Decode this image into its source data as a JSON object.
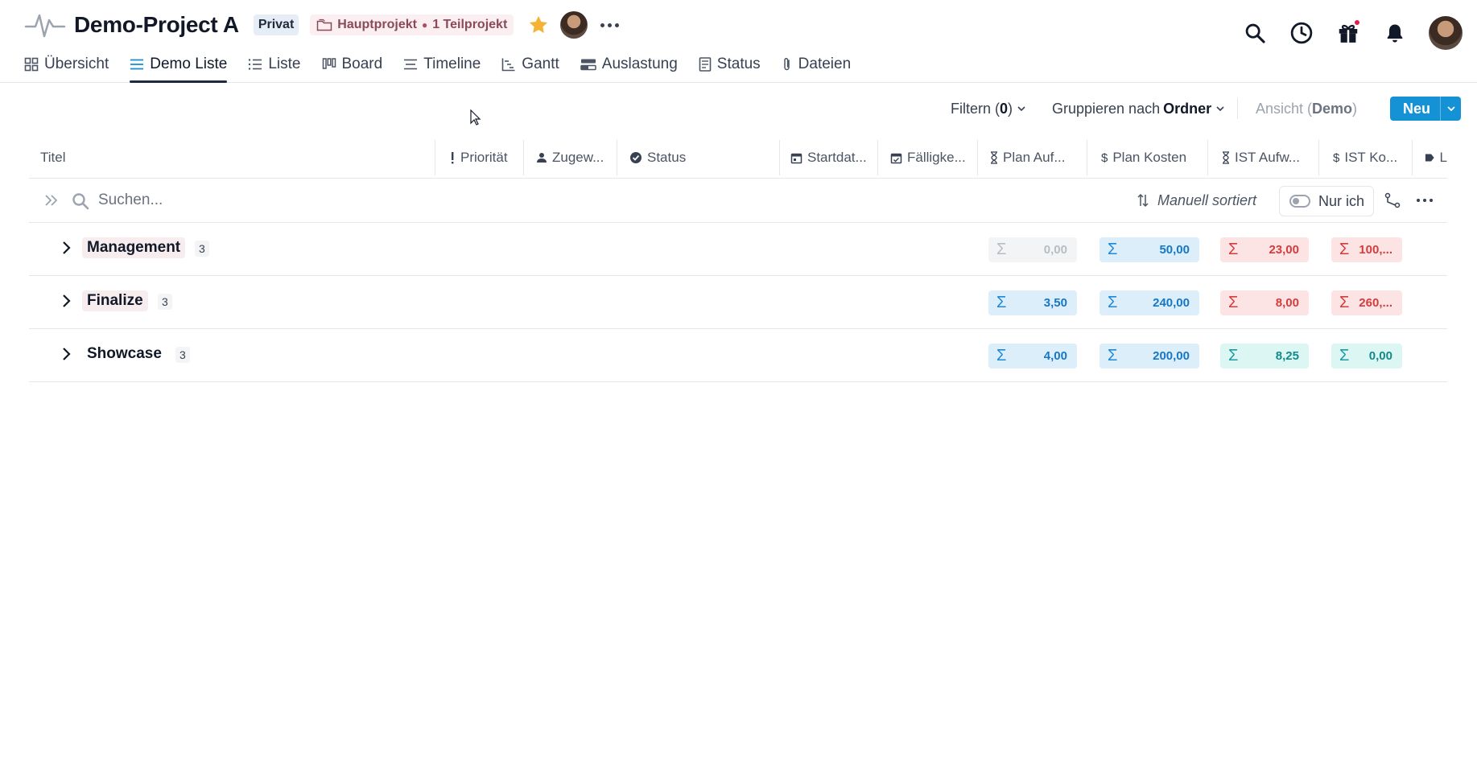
{
  "project": {
    "title": "Demo-Project A",
    "visibility": "Privat",
    "hierarchy_main": "Hauptprojekt",
    "hierarchy_sub": "1 Teilprojekt"
  },
  "tabs": [
    {
      "label": "Übersicht",
      "icon": "grid-icon",
      "active": false
    },
    {
      "label": "Demo Liste",
      "icon": "list-lines-icon",
      "active": true
    },
    {
      "label": "Liste",
      "icon": "bulleted-list-icon",
      "active": false
    },
    {
      "label": "Board",
      "icon": "board-icon",
      "active": false
    },
    {
      "label": "Timeline",
      "icon": "timeline-icon",
      "active": false
    },
    {
      "label": "Gantt",
      "icon": "gantt-icon",
      "active": false
    },
    {
      "label": "Auslastung",
      "icon": "workload-icon",
      "active": false
    },
    {
      "label": "Status",
      "icon": "status-doc-icon",
      "active": false
    },
    {
      "label": "Dateien",
      "icon": "paperclip-icon",
      "active": false
    }
  ],
  "toolbar": {
    "filter_label": "Filtern (",
    "filter_count": "0",
    "filter_close": ")",
    "group_prefix": "Gruppieren nach",
    "group_value": "Ordner",
    "view_prefix": "Ansicht (",
    "view_value": "Demo",
    "view_close": ")",
    "new_label": "Neu"
  },
  "columns": [
    {
      "label": "Titel",
      "icon": ""
    },
    {
      "label": "Priorität",
      "icon": "exclamation-icon"
    },
    {
      "label": "Zugew...",
      "icon": "person-icon"
    },
    {
      "label": "Status",
      "icon": "check-circle-icon"
    },
    {
      "label": "Startdat...",
      "icon": "calendar-icon"
    },
    {
      "label": "Fälligke...",
      "icon": "calendar-check-icon"
    },
    {
      "label": "Plan Auf...",
      "icon": "hourglass-icon"
    },
    {
      "label": "Plan Kosten",
      "icon": "dollar-icon"
    },
    {
      "label": "IST Aufw...",
      "icon": "hourglass-icon"
    },
    {
      "label": "IST Ko...",
      "icon": "dollar-icon"
    },
    {
      "label": "L",
      "icon": "tag-icon"
    }
  ],
  "search": {
    "placeholder": "Suchen...",
    "sort_label": "Manuell sortiert",
    "only_me_label": "Nur ich"
  },
  "groups": [
    {
      "name": "Management",
      "count": "3",
      "plan_aufwand": "0,00",
      "plan_kosten": "50,00",
      "ist_aufwand": "23,00",
      "ist_kosten": "100,..."
    },
    {
      "name": "Finalize",
      "count": "3",
      "plan_aufwand": "3,50",
      "plan_kosten": "240,00",
      "ist_aufwand": "8,00",
      "ist_kosten": "260,..."
    },
    {
      "name": "Showcase",
      "count": "3",
      "plan_aufwand": "4,00",
      "plan_kosten": "200,00",
      "ist_aufwand": "8,25",
      "ist_kosten": "0,00"
    }
  ],
  "sigma": "Σ",
  "colors": {
    "accent": "#1591d6",
    "star": "#f5b335",
    "notification_dot": "#e11d48"
  }
}
